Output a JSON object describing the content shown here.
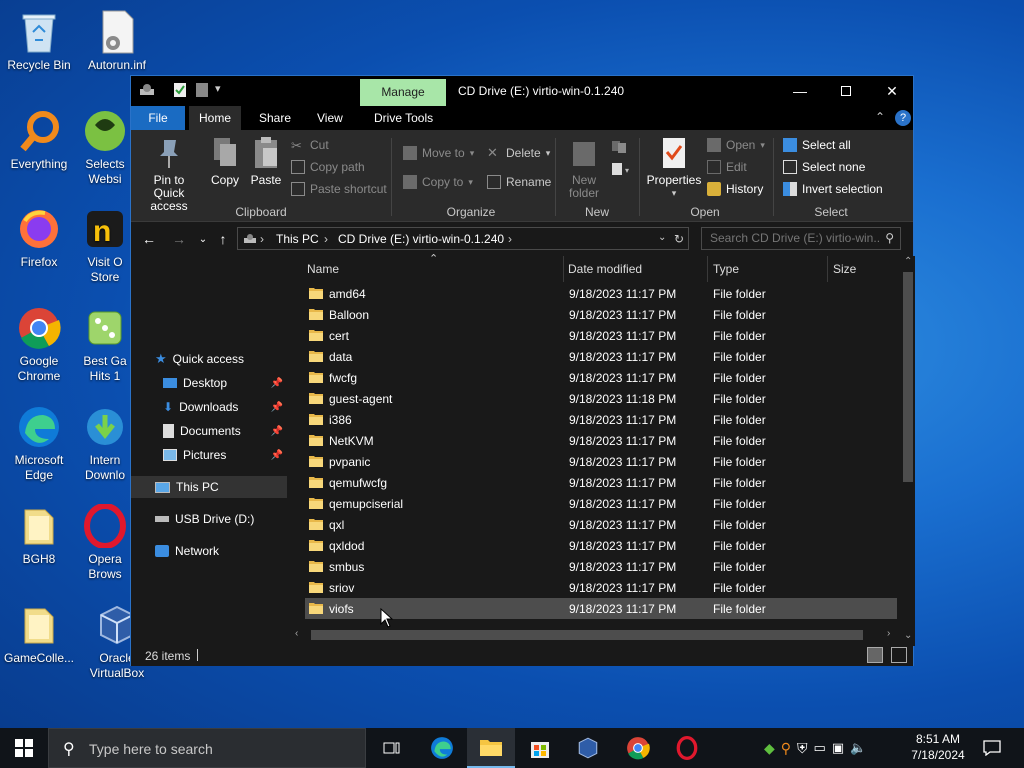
{
  "desktop": {
    "icons": [
      {
        "label": "Recycle Bin"
      },
      {
        "label": "Autorun.inf"
      },
      {
        "label": "Everything"
      },
      {
        "label": "Selects Websi"
      },
      {
        "label": "Firefox"
      },
      {
        "label": "Visit O Store"
      },
      {
        "label": "Google Chrome"
      },
      {
        "label": "Best Ga Hits 1"
      },
      {
        "label": "Microsoft Edge"
      },
      {
        "label": "Intern Downlo"
      },
      {
        "label": "BGH8"
      },
      {
        "label": "Opera Brows"
      },
      {
        "label": "GameColle..."
      },
      {
        "label": "Oracle VirtualBox"
      }
    ]
  },
  "window": {
    "title": "CD Drive (E:) virtio-win-0.1.240",
    "contextual_tab": "Manage",
    "tabs": [
      "File",
      "Home",
      "Share",
      "View",
      "Drive Tools"
    ],
    "ribbon": {
      "clipboard": {
        "label": "Clipboard",
        "pin": "Pin to Quick access",
        "copy": "Copy",
        "paste": "Paste",
        "cut": "Cut",
        "copy_path": "Copy path",
        "paste_shortcut": "Paste shortcut"
      },
      "organize": {
        "label": "Organize",
        "move_to": "Move to",
        "copy_to": "Copy to",
        "delete": "Delete",
        "rename": "Rename"
      },
      "new": {
        "label": "New",
        "new_folder": "New folder"
      },
      "open": {
        "label": "Open",
        "properties": "Properties",
        "open": "Open",
        "edit": "Edit",
        "history": "History"
      },
      "select": {
        "label": "Select",
        "select_all": "Select all",
        "select_none": "Select none",
        "invert": "Invert selection"
      }
    },
    "address": {
      "crumbs": [
        "This PC",
        "CD Drive (E:) virtio-win-0.1.240"
      ],
      "search_placeholder": "Search CD Drive (E:) virtio-win..."
    },
    "nav": {
      "quick_access": "Quick access",
      "desktop": "Desktop",
      "downloads": "Downloads",
      "documents": "Documents",
      "pictures": "Pictures",
      "this_pc": "This PC",
      "usb": "USB Drive (D:)",
      "network": "Network"
    },
    "columns": {
      "name": "Name",
      "date": "Date modified",
      "type": "Type",
      "size": "Size"
    },
    "files": [
      {
        "name": "amd64",
        "date": "9/18/2023 11:17 PM",
        "type": "File folder"
      },
      {
        "name": "Balloon",
        "date": "9/18/2023 11:17 PM",
        "type": "File folder"
      },
      {
        "name": "cert",
        "date": "9/18/2023 11:17 PM",
        "type": "File folder"
      },
      {
        "name": "data",
        "date": "9/18/2023 11:17 PM",
        "type": "File folder"
      },
      {
        "name": "fwcfg",
        "date": "9/18/2023 11:17 PM",
        "type": "File folder"
      },
      {
        "name": "guest-agent",
        "date": "9/18/2023 11:18 PM",
        "type": "File folder"
      },
      {
        "name": "i386",
        "date": "9/18/2023 11:17 PM",
        "type": "File folder"
      },
      {
        "name": "NetKVM",
        "date": "9/18/2023 11:17 PM",
        "type": "File folder"
      },
      {
        "name": "pvpanic",
        "date": "9/18/2023 11:17 PM",
        "type": "File folder"
      },
      {
        "name": "qemufwcfg",
        "date": "9/18/2023 11:17 PM",
        "type": "File folder"
      },
      {
        "name": "qemupciserial",
        "date": "9/18/2023 11:17 PM",
        "type": "File folder"
      },
      {
        "name": "qxl",
        "date": "9/18/2023 11:17 PM",
        "type": "File folder"
      },
      {
        "name": "qxldod",
        "date": "9/18/2023 11:17 PM",
        "type": "File folder"
      },
      {
        "name": "smbus",
        "date": "9/18/2023 11:17 PM",
        "type": "File folder"
      },
      {
        "name": "sriov",
        "date": "9/18/2023 11:17 PM",
        "type": "File folder"
      },
      {
        "name": "viofs",
        "date": "9/18/2023 11:17 PM",
        "type": "File folder"
      }
    ],
    "status": "26 items"
  },
  "taskbar": {
    "search_placeholder": "Type here to search",
    "time": "8:51 AM",
    "date": "7/18/2024"
  }
}
